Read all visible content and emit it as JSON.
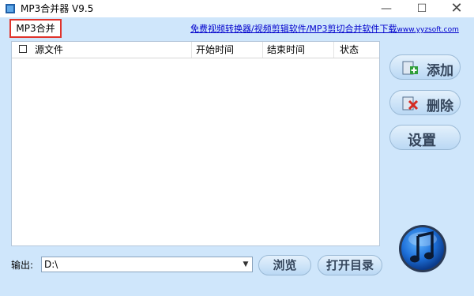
{
  "window": {
    "title": "MP3合并器 V9.5",
    "minimize": "—",
    "maximize": "☐",
    "close": "✕"
  },
  "tab": {
    "label": "MP3合并"
  },
  "link": {
    "text": "免费视频转换器/视频剪辑软件/MP3剪切合并软件下载",
    "site": "www.yyzsoft.com"
  },
  "grid": {
    "columns": {
      "source": "源文件",
      "start": "开始时间",
      "end": "结束时间",
      "status": "状态"
    },
    "rows": []
  },
  "side_buttons": {
    "add": "添加",
    "delete": "删除",
    "settings": "设置"
  },
  "output": {
    "label": "输出:",
    "value": "D:\\"
  },
  "bottom_buttons": {
    "browse": "浏览",
    "open_dir": "打开目录"
  },
  "icons": {
    "app": "app-icon",
    "add": "add-file-icon",
    "delete": "delete-file-icon",
    "music": "music-note-icon"
  },
  "colors": {
    "background": "#cfe6fb",
    "tab_highlight": "#e0332b",
    "link": "#0000cc",
    "button_text": "#35465c"
  }
}
